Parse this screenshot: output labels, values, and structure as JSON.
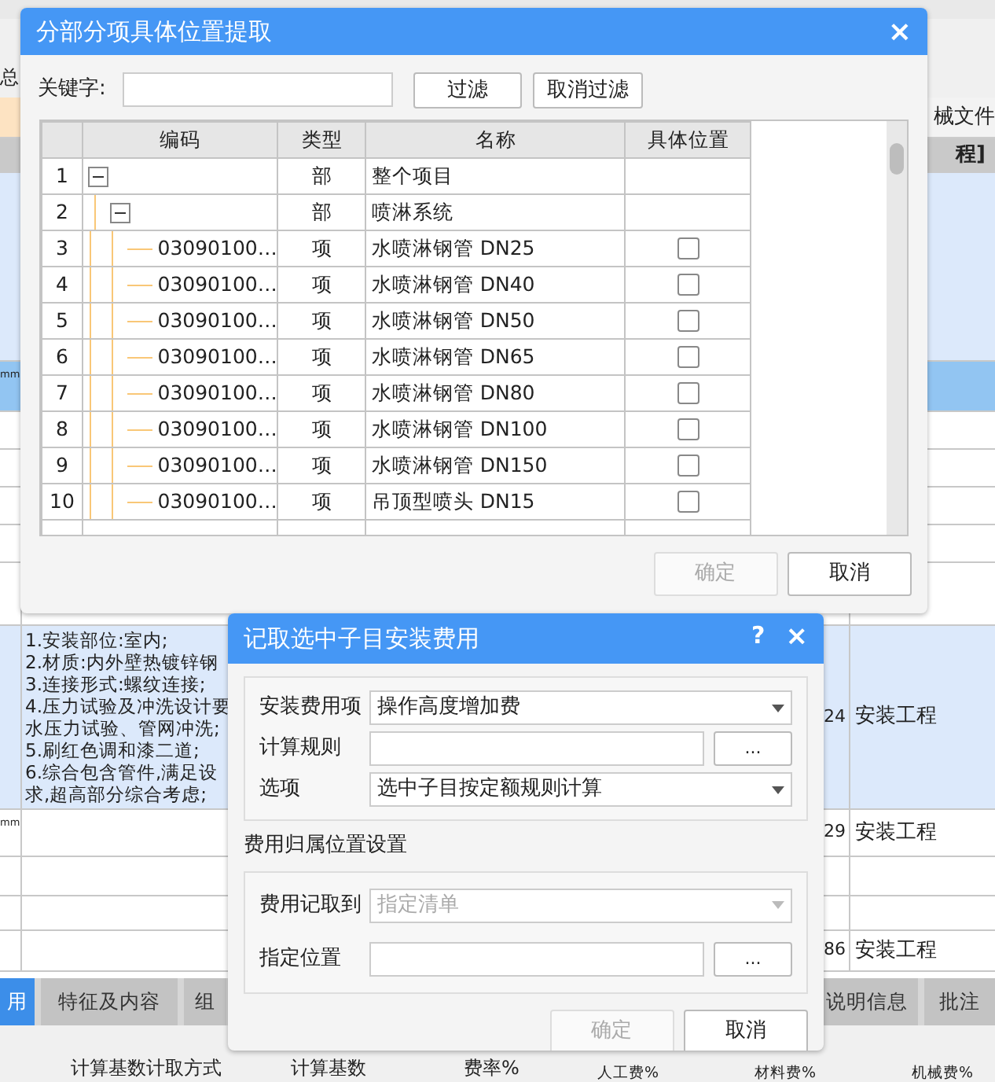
{
  "background": {
    "toolbar_label": "总",
    "header_right": "械文件",
    "header_group": "程]",
    "rows": [
      {
        "kind": "highlight",
        "left": "",
        "description": "",
        "number": "",
        "category": ""
      },
      {
        "kind": "selected",
        "left": "mm",
        "description": "",
        "number": "",
        "category": ""
      },
      {
        "kind": "plain",
        "left": "",
        "description": "",
        "number": "",
        "category": ""
      },
      {
        "kind": "plain",
        "left": "",
        "description": "",
        "number": "",
        "category": ""
      },
      {
        "kind": "plain",
        "left": "",
        "description": "",
        "number": "",
        "category": ""
      },
      {
        "kind": "plain",
        "left": "",
        "description": "",
        "number": "",
        "category": ""
      },
      {
        "kind": "plain",
        "left": "",
        "description": "",
        "number": "",
        "category": ""
      },
      {
        "kind": "highlight",
        "left": "",
        "description": [
          "1.安装部位:室内;",
          "2.材质:内外壁热镀锌钢",
          "3.连接形式:螺纹连接;",
          "4.压力试验及冲洗设计要",
          "水压力试验、管网冲洗;",
          "5.刷红色调和漆二道;",
          "6.综合包含管件,满足设",
          "求,超高部分综合考虑;"
        ],
        "number": "24",
        "category": "安装工程"
      },
      {
        "kind": "plain",
        "left": "mm",
        "description": "",
        "number": "29",
        "category": "安装工程"
      },
      {
        "kind": "plain",
        "left": "",
        "description": "",
        "number": "",
        "category": ""
      },
      {
        "kind": "plain",
        "left": "",
        "description": "",
        "number": "",
        "category": ""
      },
      {
        "kind": "plain",
        "left": "",
        "description": "",
        "number": "86",
        "category": "安装工程"
      }
    ],
    "tabs": [
      {
        "label": "用",
        "selected": true
      },
      {
        "label": "特征及内容",
        "selected": false
      },
      {
        "label": "组",
        "selected": false
      },
      {
        "label": "说明信息",
        "selected": false
      },
      {
        "label": "批注",
        "selected": false
      }
    ],
    "columns": [
      "计算基数计取方式",
      "计算基数",
      "费率%",
      "人工费%",
      "材料费%",
      "机械费%"
    ]
  },
  "location_dialog": {
    "title": "分部分项具体位置提取",
    "close": "×",
    "keyword_label": "关键字:",
    "filter_button": "过滤",
    "clear_filter_button": "取消过滤",
    "columns": [
      "编码",
      "类型",
      "名称",
      "具体位置"
    ],
    "tree": [
      {
        "number": "1",
        "type": "部",
        "name": "整个项目",
        "expanded": true,
        "children": [
          {
            "number": "2",
            "type": "部",
            "name": "喷淋系统",
            "expanded": true,
            "children": [
              {
                "number": "3",
                "code": "03090100…",
                "type": "项",
                "name": "水喷淋钢管 DN25",
                "checked": false
              },
              {
                "number": "4",
                "code": "03090100…",
                "type": "项",
                "name": "水喷淋钢管 DN40",
                "checked": false
              },
              {
                "number": "5",
                "code": "03090100…",
                "type": "项",
                "name": "水喷淋钢管 DN50",
                "checked": false
              },
              {
                "number": "6",
                "code": "03090100…",
                "type": "项",
                "name": "水喷淋钢管 DN65",
                "checked": false
              },
              {
                "number": "7",
                "code": "03090100…",
                "type": "项",
                "name": "水喷淋钢管 DN80",
                "checked": false
              },
              {
                "number": "8",
                "code": "03090100…",
                "type": "项",
                "name": "水喷淋钢管 DN100",
                "checked": false
              },
              {
                "number": "9",
                "code": "03090100…",
                "type": "项",
                "name": "水喷淋钢管 DN150",
                "checked": false
              },
              {
                "number": "10",
                "code": "03090100…",
                "type": "项",
                "name": "吊顶型喷头 DN15",
                "checked": false
              }
            ]
          }
        ]
      }
    ],
    "buttons": [
      {
        "label": "确定",
        "disabled": true
      },
      {
        "label": "取消",
        "disabled": false
      }
    ]
  },
  "fee_dialog": {
    "title": "记取选中子目安装费用",
    "help": "?",
    "close": "×",
    "fields": [
      {
        "kind": "select",
        "label": "安装费用项",
        "value": "操作高度增加费",
        "disabled": false
      },
      {
        "kind": "browse",
        "label": "计算规则",
        "button": "..."
      },
      {
        "kind": "select",
        "label": "选项",
        "value": "选中子目按定额规则计算",
        "disabled": false
      }
    ],
    "section_title": "费用归属位置设置",
    "section_fields": [
      {
        "kind": "select",
        "label": "费用记取到",
        "value": "指定清单",
        "disabled": true
      },
      {
        "kind": "browse",
        "label": "指定位置",
        "button": "..."
      }
    ],
    "buttons": [
      {
        "label": "确定",
        "disabled": true
      },
      {
        "label": "取消",
        "disabled": false
      }
    ]
  }
}
